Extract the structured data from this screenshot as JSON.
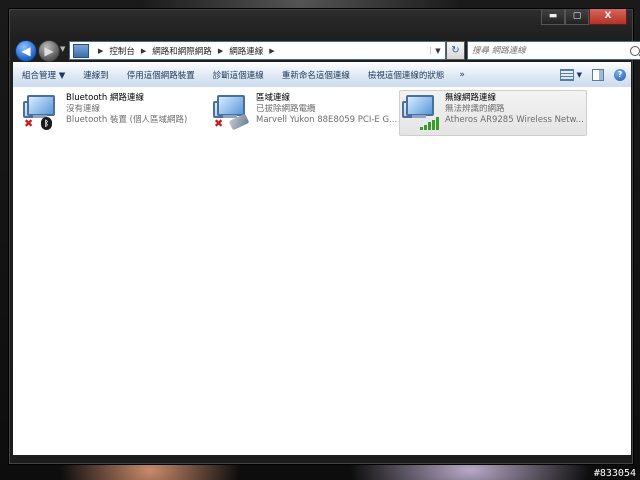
{
  "window": {
    "caption_buttons": {
      "minimize": "▬",
      "maximize": "▢",
      "close": "X"
    }
  },
  "address_bar": {
    "breadcrumbs": [
      "控制台",
      "網路和網際網路",
      "網路連線"
    ],
    "icon": "control-panel-icon"
  },
  "search": {
    "placeholder": "搜尋 網路連線"
  },
  "command_bar": {
    "organize": "組合管理",
    "connect_to": "連線到",
    "disable_device": "停用這個網路裝置",
    "diagnose": "診斷這個連線",
    "rename": "重新命名這個連線",
    "view_status": "檢視這個連線的狀態",
    "more": "»"
  },
  "connections": [
    {
      "name": "Bluetooth 網路連線",
      "status": "沒有連線",
      "device": "Bluetooth 裝置 (個人區域網路)",
      "icon": "bluetooth-network-icon",
      "overlay": "disconnected-x-icon"
    },
    {
      "name": "區域連線",
      "status": "已拔除網路電纜",
      "device": "Marvell Yukon 88E8059 PCI-E G...",
      "icon": "ethernet-network-icon",
      "overlay": "disconnected-x-icon"
    },
    {
      "name": "無線網路連線",
      "status": "無法辨識的網路",
      "device": "Atheros AR9285 Wireless Netw...",
      "icon": "wireless-network-icon",
      "overlay": "signal-bars-icon",
      "selected": true
    }
  ],
  "watermark": "#833054"
}
